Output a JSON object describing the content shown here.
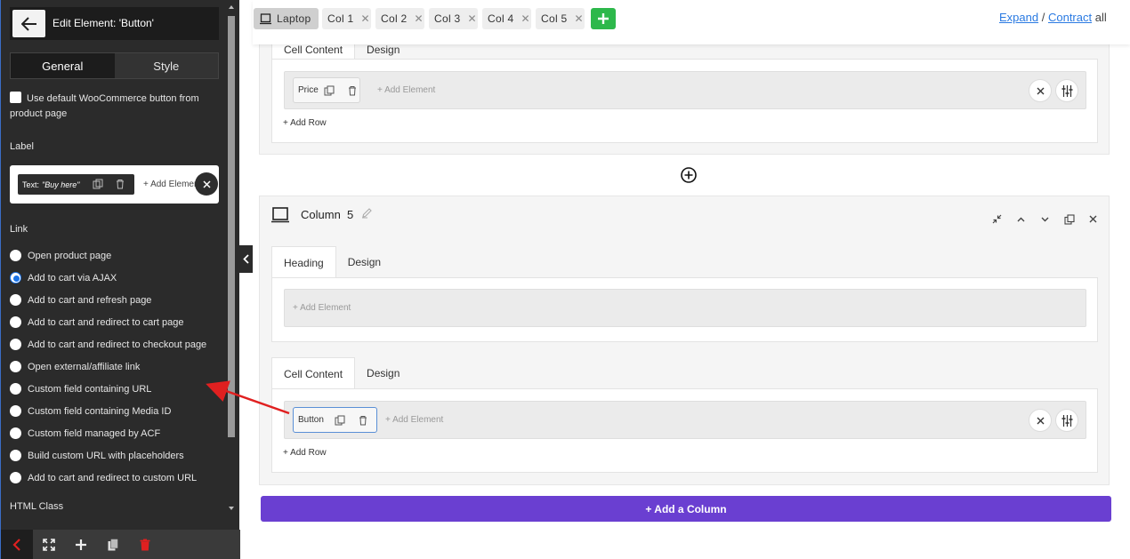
{
  "panel": {
    "title": "Edit Element: 'Button'",
    "tabs": [
      "General",
      "Style"
    ],
    "woo_checkbox_label": "Use default WooCommerce button from product page",
    "label_section": "Label",
    "label_chip_prefix": "Text:",
    "label_chip_value": "\"Buy here\"",
    "label_add": "+ Add Element",
    "link_section": "Link",
    "link_options": [
      "Open product page",
      "Add to cart via AJAX",
      "Add to cart and refresh page",
      "Add to cart and redirect to cart page",
      "Add to cart and redirect to checkout page",
      "Open external/affiliate link",
      "Custom field containing URL",
      "Custom field containing Media ID",
      "Custom field managed by ACF",
      "Build custom URL with placeholders",
      "Add to cart and redirect to custom URL"
    ],
    "link_selected": "Add to cart via AJAX",
    "html_class_section": "HTML Class"
  },
  "topbar": {
    "device": "Laptop",
    "columns": [
      "Col 1",
      "Col 2",
      "Col 3",
      "Col 4",
      "Col 5"
    ],
    "expand": "Expand",
    "separator": "/",
    "contract": "Contract",
    "all": "all"
  },
  "col4": {
    "tabs": [
      "Cell Content",
      "Design"
    ],
    "element": "Price",
    "add_element": "+ Add Element",
    "add_row": "+ Add Row"
  },
  "col5": {
    "title": "Column",
    "number": "5",
    "heading_tabs": [
      "Heading",
      "Design"
    ],
    "heading_add": "+ Add Element",
    "cell_tabs": [
      "Cell Content",
      "Design"
    ],
    "element": "Button",
    "add_element": "+ Add Element",
    "add_row": "+ Add Row"
  },
  "add_column": "+ Add a Column",
  "colors": {
    "panel_bg": "#2b2b2b",
    "accent_green": "#2db84b",
    "accent_purple": "#6a3fd1",
    "link_blue": "#2a7ae2",
    "arrow_red": "#e02020"
  }
}
